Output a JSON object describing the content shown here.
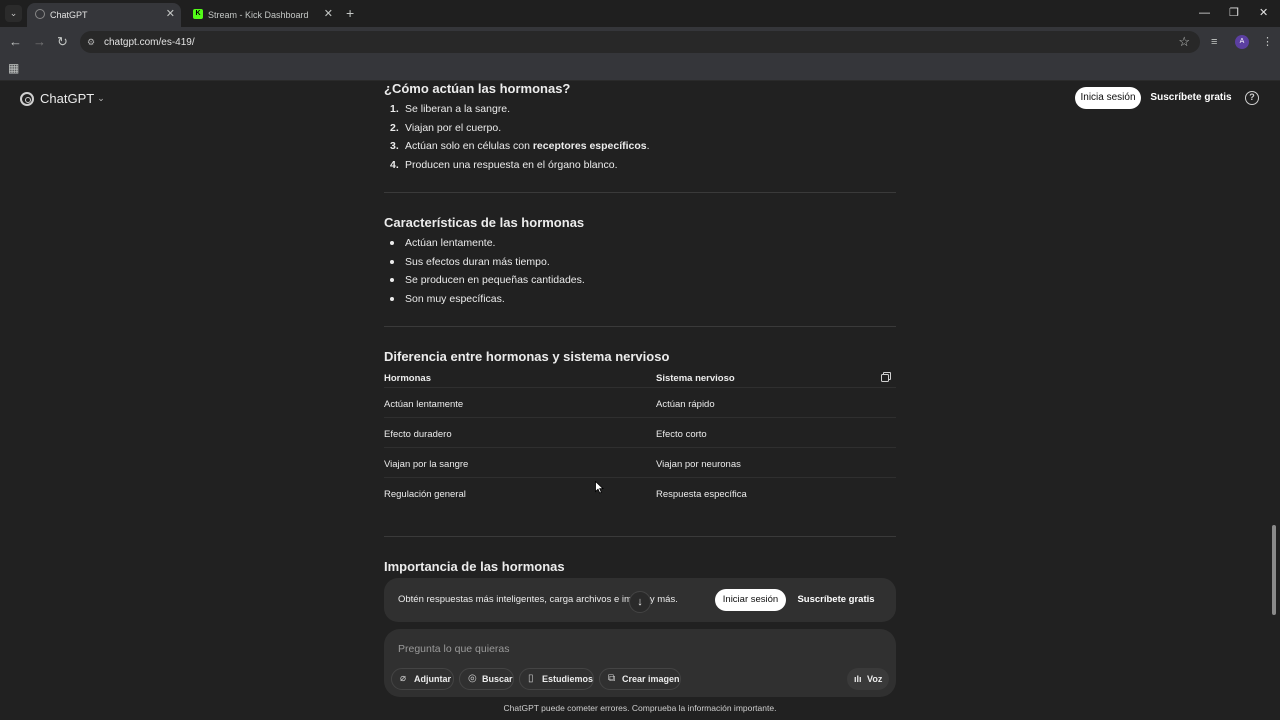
{
  "browser": {
    "tabs": [
      {
        "title": "ChatGPT",
        "active": true
      },
      {
        "title": "Stream - Kick Dashboard",
        "active": false
      }
    ],
    "url": "chatgpt.com/es-419/",
    "profile_initial": "A"
  },
  "header": {
    "brand": "ChatGPT",
    "login_label": "Inicia sesión",
    "signup_label": "Suscríbete gratis",
    "help_label": "?"
  },
  "sections": {
    "how": {
      "title": "¿Cómo actúan las hormonas?",
      "items": [
        {
          "num": "1.",
          "text": "Se liberan a la sangre."
        },
        {
          "num": "2.",
          "text": "Viajan por el cuerpo."
        },
        {
          "num": "3.",
          "text_before": "Actúan solo en células con ",
          "text_bold": "receptores específicos",
          "text_after": "."
        },
        {
          "num": "4.",
          "text": "Producen una respuesta en el órgano blanco."
        }
      ]
    },
    "traits": {
      "title": "Características de las hormonas",
      "items": [
        "Actúan lentamente.",
        "Sus efectos duran más tiempo.",
        "Se producen en pequeñas cantidades.",
        "Son muy específicas."
      ]
    },
    "diff": {
      "title": "Diferencia entre hormonas y sistema nervioso",
      "headers": [
        "Hormonas",
        "Sistema nervioso"
      ],
      "rows": [
        [
          "Actúan lentamente",
          "Actúan rápido"
        ],
        [
          "Efecto duradero",
          "Efecto corto"
        ],
        [
          "Viajan por la sangre",
          "Viajan por neuronas"
        ],
        [
          "Regulación general",
          "Respuesta específica"
        ]
      ]
    },
    "importance": {
      "title": "Importancia de las hormonas"
    }
  },
  "banner": {
    "text": "Obtén respuestas más inteligentes, carga archivos e imá   s, y más.",
    "login_label": "Iniciar sesión",
    "signup_label": "Suscríbete gratis"
  },
  "composer": {
    "placeholder": "Pregunta lo que quieras",
    "tools": [
      "Adjuntar",
      "Buscar",
      "Estudiemos",
      "Crear imagen"
    ],
    "voice_label": "Voz"
  },
  "disclaimer": "ChatGPT puede cometer errores. Comprueba la información importante."
}
